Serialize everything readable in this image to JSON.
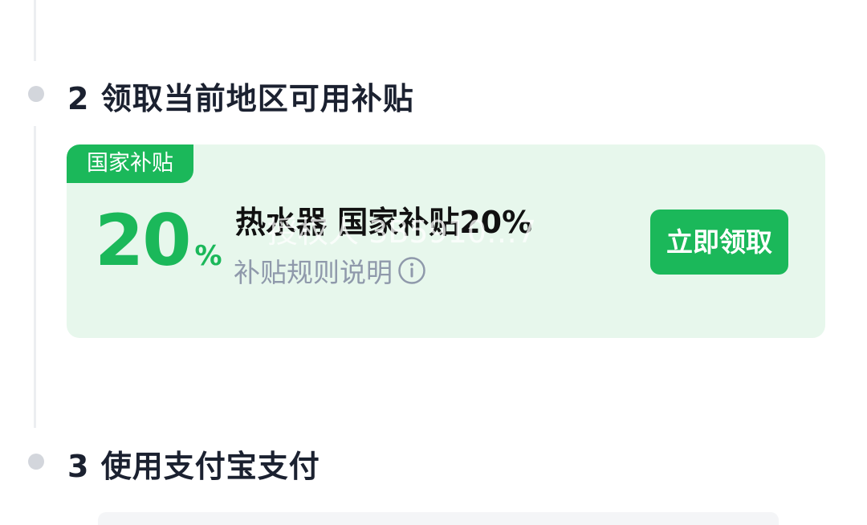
{
  "steps": {
    "step2": {
      "number": "2",
      "title": "领取当前地区可用补贴"
    },
    "step3": {
      "number": "3",
      "title": "使用支付宝支付"
    }
  },
  "subsidy_card": {
    "tag": "国家补贴",
    "discount_value": "20",
    "discount_unit": "%",
    "product_title": "热水器 国家补贴20%",
    "watermark": "授权人 3B5910…7",
    "rules_link": "补贴规则说明",
    "rules_icon": "info-icon",
    "claim_button": "立即领取"
  },
  "colors": {
    "accent_green": "#1bb85a",
    "card_background": "#e7f7ec",
    "title_text": "#1b2130",
    "muted_text": "#8f99ab",
    "timeline": "#d3d6dc"
  }
}
